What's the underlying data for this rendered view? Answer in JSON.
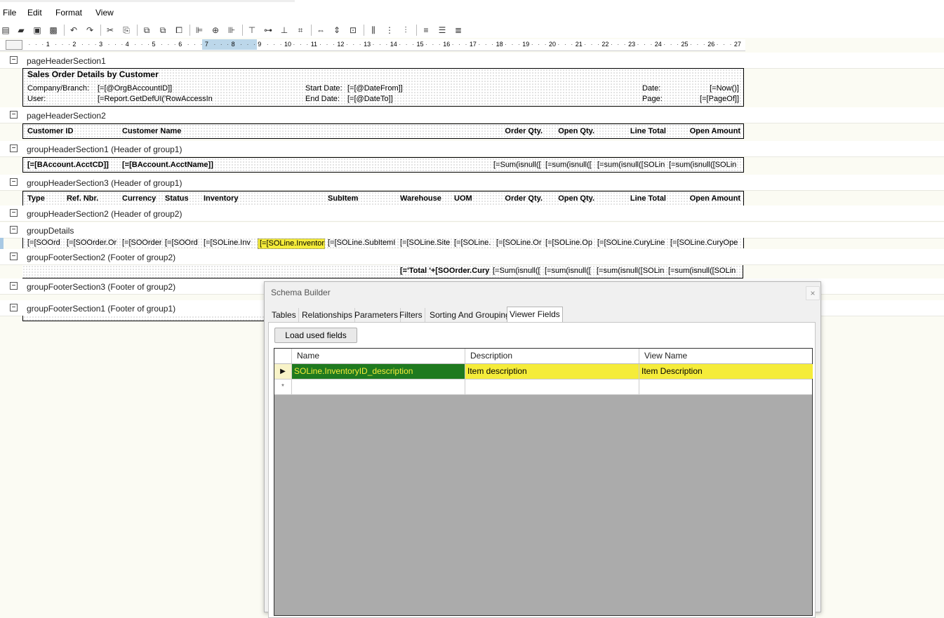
{
  "menu": [
    "File",
    "Edit",
    "Format",
    "View"
  ],
  "toolbar_icons": [
    "new-icon",
    "open-icon",
    "save-icon",
    "save-all-icon",
    "undo-icon",
    "redo-icon",
    "cut-icon",
    "copy-icon",
    "bring-front-icon",
    "send-back-icon",
    "group-icon",
    "align-left-icon",
    "align-center-icon",
    "align-right-icon",
    "align-top-icon",
    "align-middle-icon",
    "align-bottom-icon",
    "align-grid-icon",
    "same-width-icon",
    "same-height-icon",
    "same-size-icon",
    "hspace-equal-icon",
    "hspace-increase-icon",
    "hspace-decrease-icon",
    "vspace-equal-icon",
    "vspace-increase-icon",
    "vspace-decrease-icon"
  ],
  "ruler": {
    "numbers": [
      "1",
      "2",
      "3",
      "4",
      "5",
      "6",
      "7",
      "8",
      "9",
      "10",
      "11",
      "12",
      "13",
      "14",
      "15",
      "16",
      "17",
      "18",
      "19",
      "20",
      "21",
      "22",
      "23",
      "24",
      "25",
      "26",
      "27"
    ],
    "highlight_range": [
      7,
      8
    ]
  },
  "sections": [
    {
      "label": "pageHeaderSection1"
    },
    {
      "label": "pageHeaderSection2"
    },
    {
      "label": "groupHeaderSection1 (Header of group1)"
    },
    {
      "label": "groupHeaderSection3 (Header of group1)"
    },
    {
      "label": "groupHeaderSection2 (Header of group2)"
    },
    {
      "label": "groupDetails"
    },
    {
      "label": "groupFooterSection2 (Footer of group2)"
    },
    {
      "label": "groupFooterSection3 (Footer of group2)"
    },
    {
      "label": "groupFooterSection1 (Footer of group1)"
    }
  ],
  "page_header1": {
    "title": "Sales Order Details by Customer",
    "company_label": "Company/Branch:",
    "company_value": "[=[@OrgBAccountID]]",
    "user_label": "User:",
    "user_value": "[=Report.GetDefUI('RowAccessIn",
    "start_label": "Start Date:",
    "start_value": "[=[@DateFrom]]",
    "end_label": "End Date:",
    "end_value": "[=[@DateTo]]",
    "date_label": "Date:",
    "date_value": "[=Now()]",
    "page_label": "Page:",
    "page_value": "[=[PageOf]]"
  },
  "page_header2": {
    "cols": [
      "Customer ID",
      "Customer Name",
      "Order Qty.",
      "Open Qty.",
      "Line Total",
      "Open Amount"
    ]
  },
  "group_header1": {
    "fields": [
      "[=[BAccount.AcctCD]]",
      "[=[BAccount.AcctName]]",
      "[=Sum(isnull([",
      "[=sum(isnull([",
      "[=sum(isnull([SOLin",
      "[=sum(isnull([SOLin"
    ]
  },
  "group_header3": {
    "cols": [
      "Type",
      "Ref. Nbr.",
      "Currency",
      "Status",
      "Inventory",
      "SubItem",
      "Warehouse",
      "UOM",
      "Order Qty.",
      "Open Qty.",
      "Line Total",
      "Open Amount"
    ]
  },
  "details": {
    "fields": [
      "[=[SOOrd",
      "[=[SOOrder.Or",
      "[=[SOOrder",
      "[=[SOOrd",
      "[=[SOLine.Inv",
      "[=[SOLine.Inventor",
      "[=[SOLine.SubItemI",
      "[=[SOLine.Site",
      "[=[SOLine.",
      "[=[SOLine.Or",
      "[=[SOLine.Op",
      "[=[SOLine.CuryLine",
      "[=[SOLine.CuryOpe"
    ]
  },
  "group_footer2": {
    "fields": [
      "[='Total '+[SOOrder.Cury",
      "[=Sum(isnull([",
      "[=sum(isnull([",
      "[=sum(isnull([SOLin",
      "[=sum(isnull([SOLin"
    ]
  },
  "dialog": {
    "title": "Schema Builder",
    "close": "×",
    "tabs": [
      "Tables",
      "Relationships",
      "Parameters",
      "Filters",
      "Sorting And Grouping",
      "Viewer Fields"
    ],
    "active_tab": "Viewer Fields",
    "load_button": "Load used fields",
    "grid": {
      "columns": [
        "Name",
        "Description",
        "View Name"
      ],
      "rows": [
        {
          "marker": "▶",
          "name": "SOLine.InventoryID_description",
          "description": "Item description",
          "view_name": "Item Description"
        },
        {
          "marker": "*",
          "name": "",
          "description": "",
          "view_name": ""
        }
      ]
    }
  },
  "colors": {
    "selection_green": "#1f7a1f",
    "highlight_yellow": "#f5ec3a",
    "ruler_highlight": "#bcd7ea",
    "grid_empty": "#ababab"
  }
}
